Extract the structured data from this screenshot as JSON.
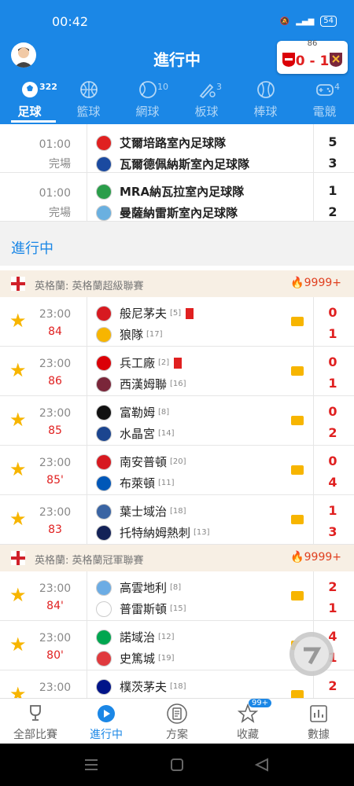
{
  "status": {
    "time": "00:42",
    "battery": "54"
  },
  "header": {
    "title": "進行中",
    "score_popup": {
      "minute": "86",
      "score": "0 - 1"
    }
  },
  "tabs": [
    {
      "label": "足球",
      "count": "322",
      "icon": "soccer-ball-icon",
      "active": true
    },
    {
      "label": "籃球",
      "count": "",
      "icon": "basketball-icon"
    },
    {
      "label": "網球",
      "count": "10",
      "icon": "tennis-icon"
    },
    {
      "label": "板球",
      "count": "3",
      "icon": "cricket-icon"
    },
    {
      "label": "棒球",
      "count": "",
      "icon": "baseball-icon"
    },
    {
      "label": "電競",
      "count": "4",
      "icon": "gamepad-icon"
    }
  ],
  "finished": [
    {
      "time": "01:00",
      "status": "完場",
      "home": "艾爾培路室內足球隊",
      "away": "瓦爾德佩納斯室內足球隊",
      "home_score": "5",
      "away_score": "3"
    },
    {
      "time": "01:00",
      "status": "完場",
      "home": "MRA納瓦拉室內足球隊",
      "away": "曼薩納雷斯室內足球隊",
      "home_score": "1",
      "away_score": "2"
    }
  ],
  "section_title": "進行中",
  "leagues": [
    {
      "name": "英格蘭: 英格蘭超級聯賽",
      "heat": "9999+",
      "matches": [
        {
          "time": "23:00",
          "minute": "84",
          "home": "般尼茅夫",
          "home_rank": "[5]",
          "home_red": true,
          "away": "狼隊",
          "away_rank": "[17]",
          "home_score": "0",
          "away_score": "1"
        },
        {
          "time": "23:00",
          "minute": "86",
          "home": "兵工廠",
          "home_rank": "[2]",
          "home_red": true,
          "away": "西漢姆聯",
          "away_rank": "[16]",
          "home_score": "0",
          "away_score": "1"
        },
        {
          "time": "23:00",
          "minute": "85",
          "home": "富勒姆",
          "home_rank": "[8]",
          "away": "水晶宮",
          "away_rank": "[14]",
          "home_score": "0",
          "away_score": "2"
        },
        {
          "time": "23:00",
          "minute": "85'",
          "home": "南安普頓",
          "home_rank": "[20]",
          "away": "布萊頓",
          "away_rank": "[11]",
          "home_score": "0",
          "away_score": "4"
        },
        {
          "time": "23:00",
          "minute": "83",
          "home": "葉士域治",
          "home_rank": "[18]",
          "away": "托特納姆熱刺",
          "away_rank": "[13]",
          "home_score": "1",
          "away_score": "3"
        }
      ]
    },
    {
      "name": "英格蘭: 英格蘭冠軍聯賽",
      "heat": "9999+",
      "matches": [
        {
          "time": "23:00",
          "minute": "84'",
          "home": "高雲地利",
          "home_rank": "[8]",
          "away": "普雷斯頓",
          "away_rank": "[15]",
          "home_score": "2",
          "away_score": "1"
        },
        {
          "time": "23:00",
          "minute": "80'",
          "home": "諾域治",
          "home_rank": "[12]",
          "away": "史篤城",
          "away_rank": "[19]",
          "home_score": "4",
          "away_score": "1"
        },
        {
          "time": "23:00",
          "minute": "",
          "home": "樸茨茅夫",
          "home_rank": "[18]",
          "away": "",
          "away_rank": "",
          "home_score": "2",
          "away_score": ""
        }
      ]
    }
  ],
  "bottom_nav": [
    {
      "label": "全部比賽",
      "icon": "trophy-icon"
    },
    {
      "label": "進行中",
      "icon": "play-icon",
      "active": true
    },
    {
      "label": "方案",
      "icon": "document-icon"
    },
    {
      "label": "收藏",
      "icon": "star-icon",
      "badge": "99+"
    },
    {
      "label": "數據",
      "icon": "chart-icon"
    }
  ],
  "colors": {
    "primary": "#1b87e6",
    "live_red": "#e02020",
    "star": "#f7b500"
  }
}
